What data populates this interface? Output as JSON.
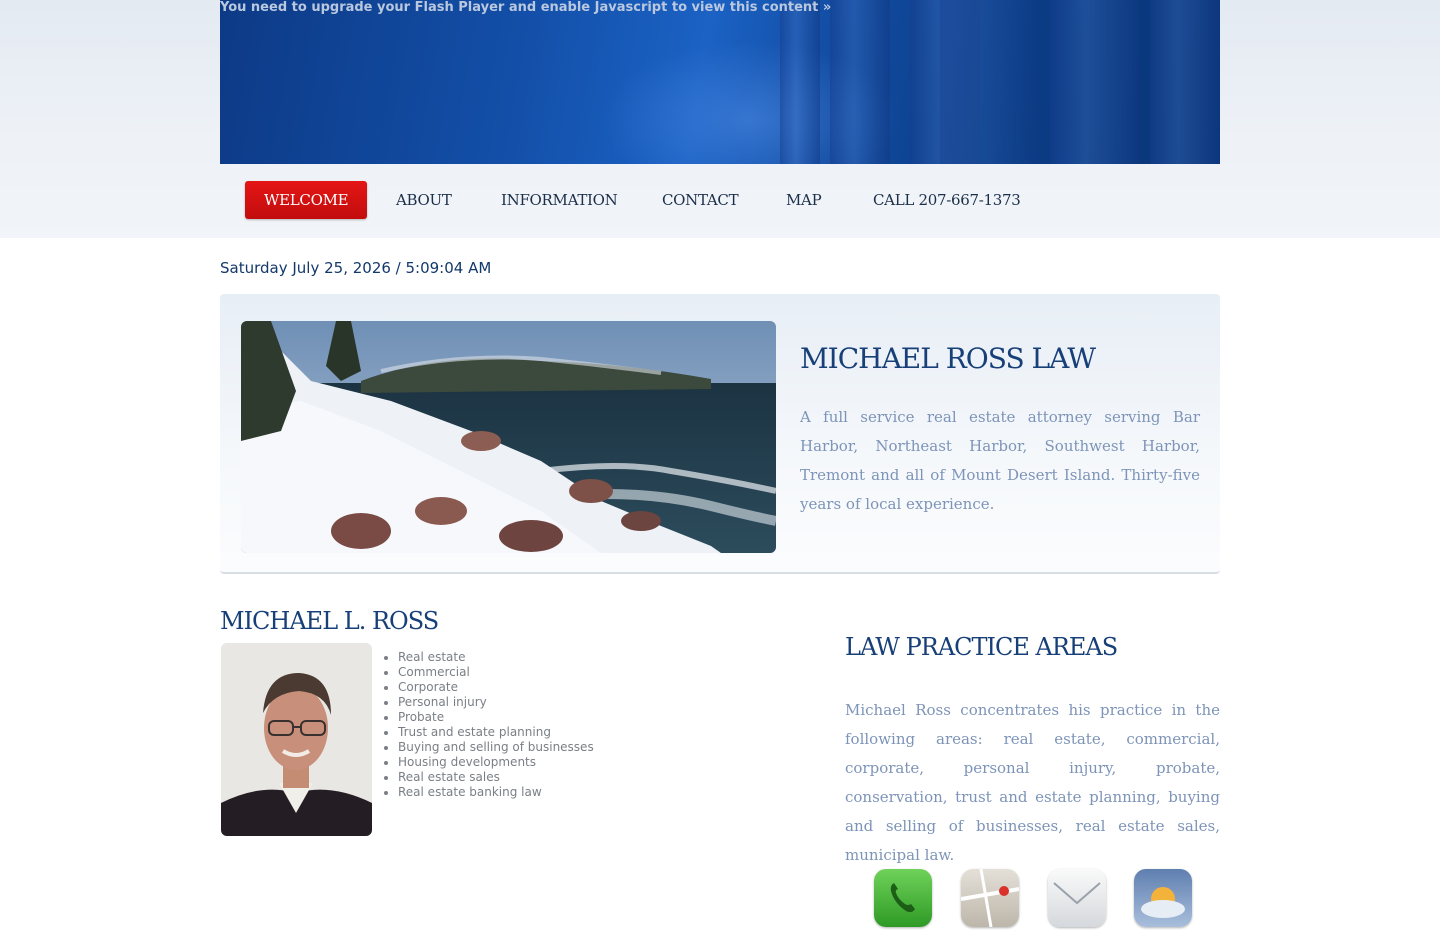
{
  "flash_message": "You need to upgrade your Flash Player and enable Javascript to view this content »",
  "nav": {
    "items": [
      {
        "label": "WELCOME"
      },
      {
        "label": "ABOUT"
      },
      {
        "label": "INFORMATION"
      },
      {
        "label": "CONTACT"
      },
      {
        "label": "MAP"
      },
      {
        "label": "CALL 207-667-1373"
      }
    ],
    "active": "WELCOME"
  },
  "datetime": "Saturday July 25, 2026 / 5:09:04 AM",
  "feature": {
    "title": "MICHAEL ROSS LAW",
    "description": "A full service real estate attorney serving Bar Harbor, Northeast Harbor, Southwest Harbor, Tremont and all of Mount Desert Island.  Thirty-five years of local experience."
  },
  "attorney": {
    "name": "MICHAEL L. ROSS",
    "practice_list": [
      "Real estate",
      "Commercial",
      "Corporate",
      "Personal injury",
      "Probate",
      "Trust and estate planning",
      "Buying and selling of businesses",
      "Housing developments",
      "Real estate sales",
      "Real estate banking law"
    ]
  },
  "practice_areas": {
    "title": "LAW PRACTICE AREAS",
    "description": "Michael Ross concentrates his practice in the following areas:  real estate, commercial, corporate, personal injury, probate, conservation, trust and estate planning, buying and selling of businesses, real estate sales, municipal law."
  },
  "app_icons": [
    "phone-icon",
    "map-icon",
    "mail-icon",
    "weather-icon"
  ],
  "colors": {
    "banner_blue": "#134fa8",
    "active_nav_red": "#d41010",
    "heading_blue": "#173f78",
    "body_text_blue": "#7d94b8"
  }
}
